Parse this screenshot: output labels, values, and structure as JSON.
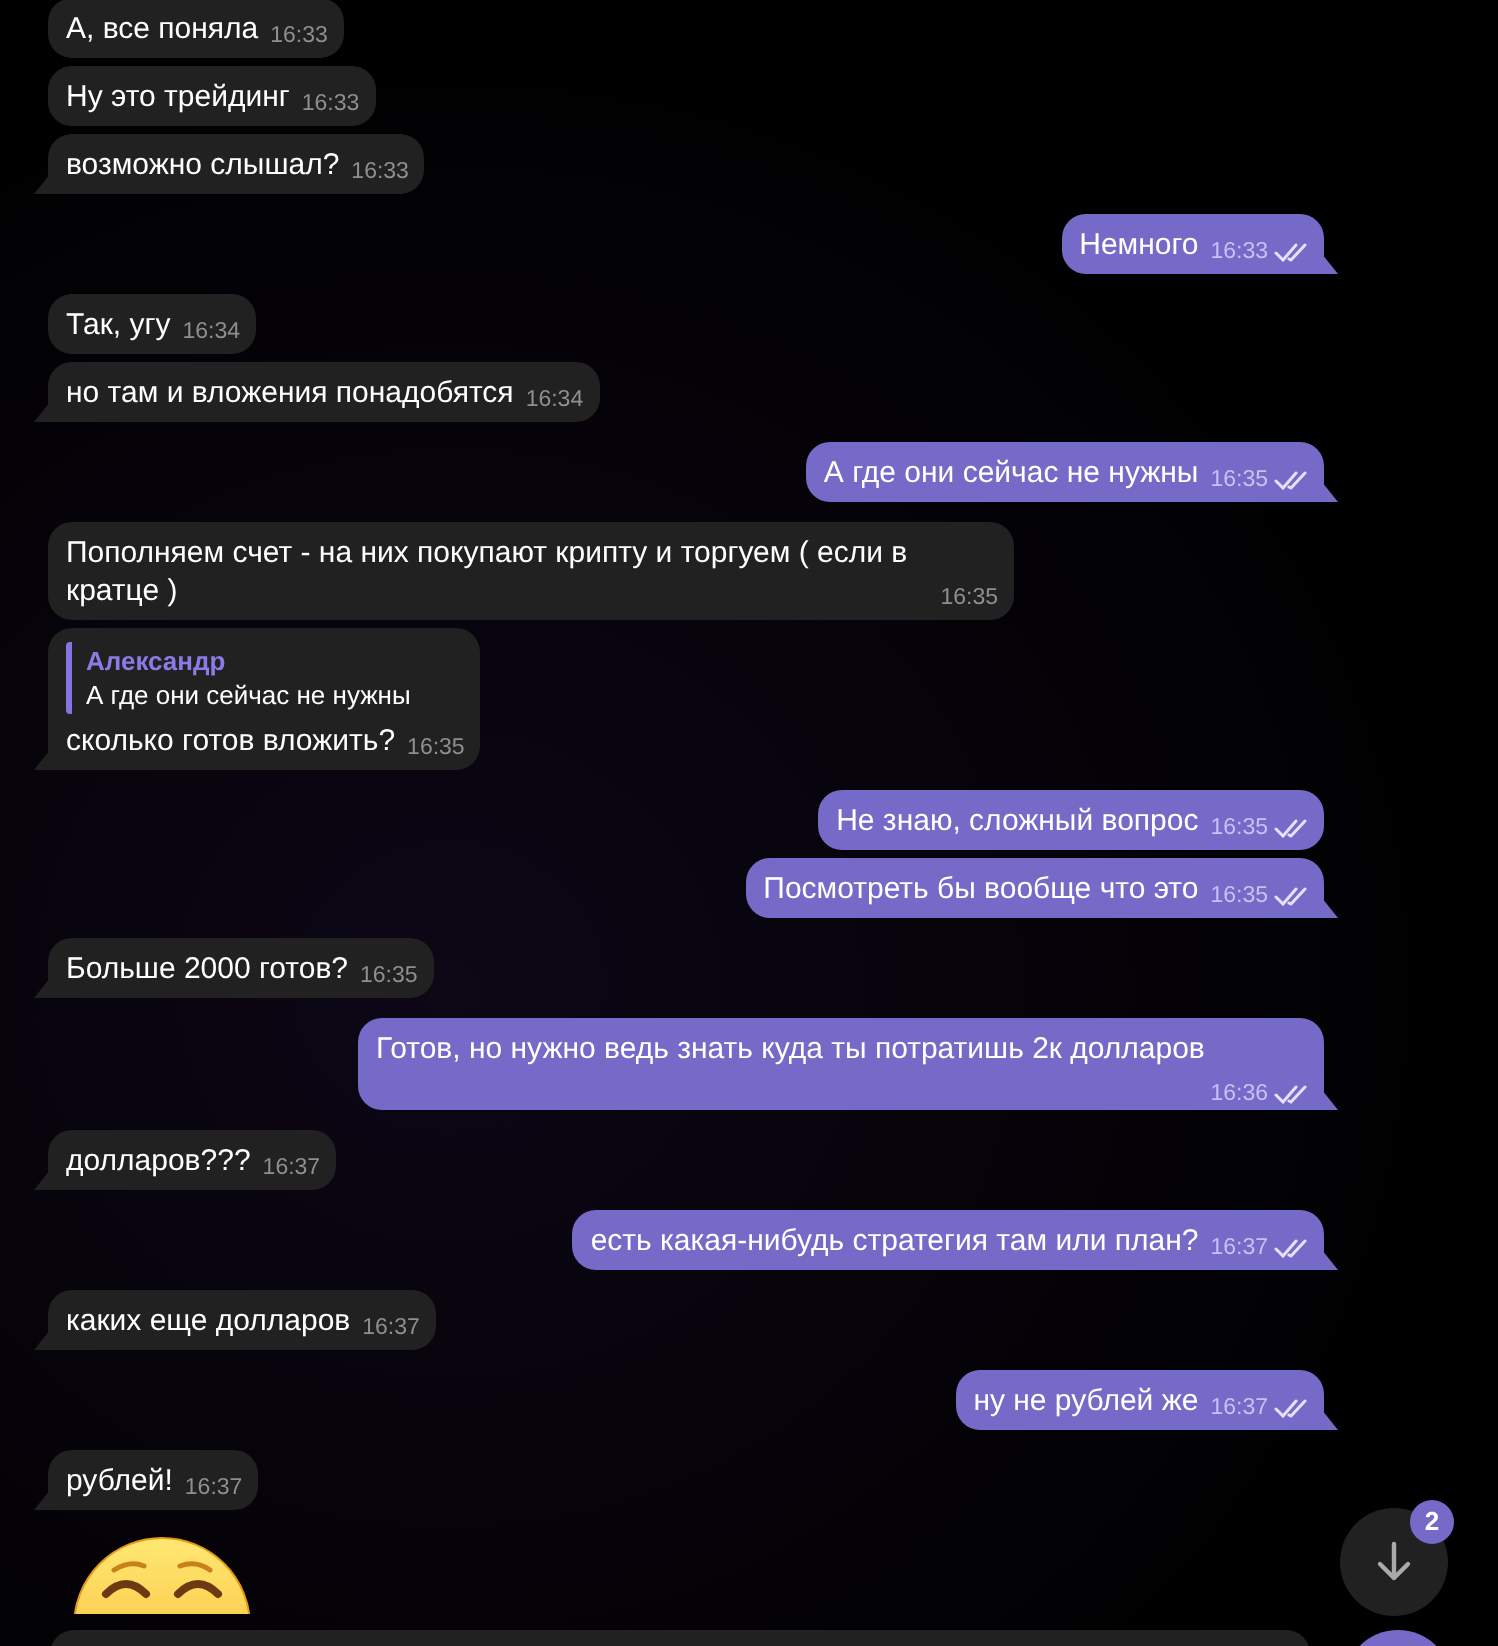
{
  "messages": [
    {
      "kind": "text",
      "outgoing": false,
      "text": "А, все поняла",
      "time": "16:33"
    },
    {
      "kind": "text",
      "outgoing": false,
      "text": "Ну это трейдинг",
      "time": "16:33"
    },
    {
      "kind": "text",
      "outgoing": false,
      "text": "возможно слышал?",
      "time": "16:33"
    },
    {
      "kind": "text",
      "outgoing": true,
      "text": "Немного",
      "time": "16:33",
      "read": true
    },
    {
      "kind": "text",
      "outgoing": false,
      "text": "Так, угу",
      "time": "16:34"
    },
    {
      "kind": "text",
      "outgoing": false,
      "text": "но там и вложения понадобятся",
      "time": "16:34"
    },
    {
      "kind": "text",
      "outgoing": true,
      "text": "А где они сейчас не нужны",
      "time": "16:35",
      "read": true
    },
    {
      "kind": "text",
      "outgoing": false,
      "text": "Пополняем счет - на них покупают крипту и торгуем ( если в кратце )",
      "time": "16:35"
    },
    {
      "kind": "text",
      "outgoing": false,
      "text": "сколько готов вложить?",
      "time": "16:35",
      "reply": {
        "author": "Александр",
        "text": "А где они сейчас не нужны"
      }
    },
    {
      "kind": "text",
      "outgoing": true,
      "text": "Не знаю, сложный вопрос",
      "time": "16:35",
      "read": true
    },
    {
      "kind": "text",
      "outgoing": true,
      "text": "Посмотреть бы вообще что это",
      "time": "16:35",
      "read": true
    },
    {
      "kind": "text",
      "outgoing": false,
      "text": "Больше 2000 готов?",
      "time": "16:35"
    },
    {
      "kind": "text",
      "outgoing": true,
      "text": "Готов, но нужно ведь знать куда ты потратишь 2к долларов",
      "time": "16:36",
      "read": true
    },
    {
      "kind": "text",
      "outgoing": false,
      "text": "долларов???",
      "time": "16:37"
    },
    {
      "kind": "text",
      "outgoing": true,
      "text": "есть какая-нибудь стратегия там или план?",
      "time": "16:37",
      "read": true
    },
    {
      "kind": "text",
      "outgoing": false,
      "text": "каких еще долларов",
      "time": "16:37"
    },
    {
      "kind": "text",
      "outgoing": true,
      "text": "ну не рублей же",
      "time": "16:37",
      "read": true
    },
    {
      "kind": "text",
      "outgoing": false,
      "text": "рублей!",
      "time": "16:37"
    },
    {
      "kind": "sticker",
      "outgoing": false
    }
  ],
  "scroll_button": {
    "unread_count": "2"
  }
}
